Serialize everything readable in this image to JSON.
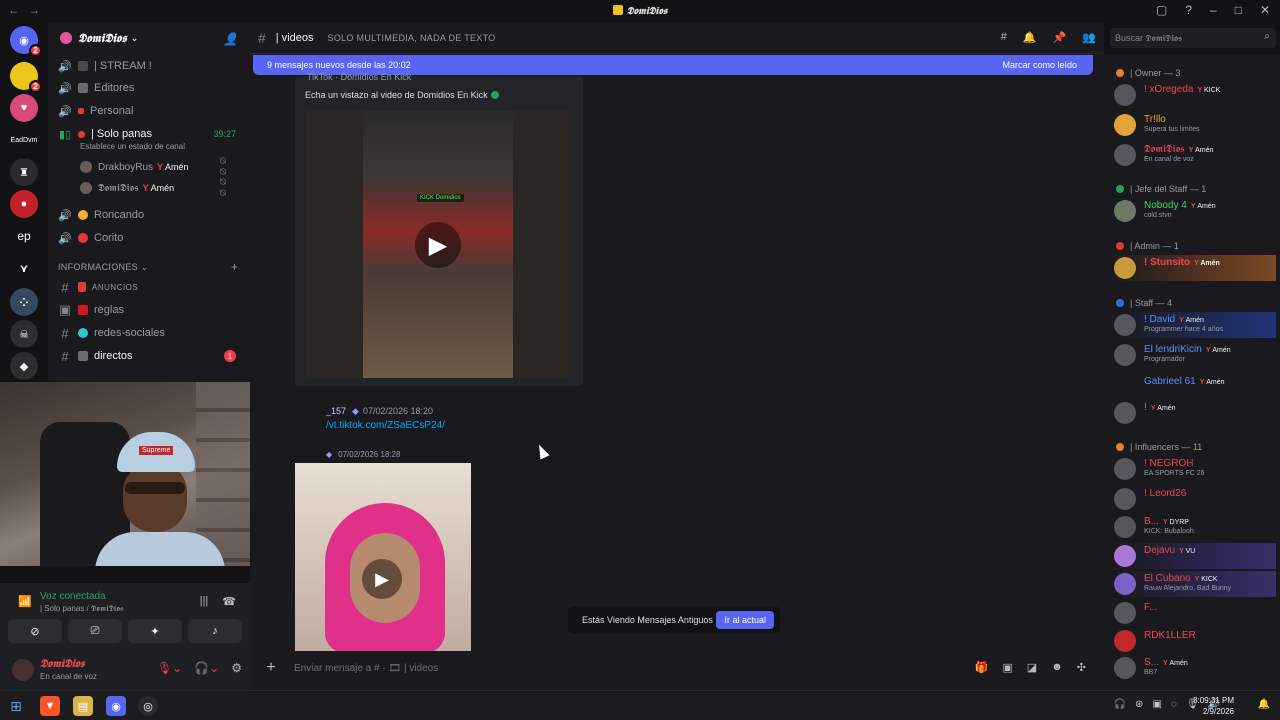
{
  "window": {
    "title": "𝕯𝖔𝖒𝖎𝕯𝖎𝖔𝖘"
  },
  "guild": {
    "name": "𝕯𝖔𝖒𝖎𝕯𝖎𝖔𝖘"
  },
  "channels": {
    "voice": [
      {
        "label": "| STREAM !"
      },
      {
        "label": "Editores"
      },
      {
        "label": "Personal"
      },
      {
        "label": "| Solo panas",
        "time": "39:27",
        "status": "Establece un estado de canal"
      },
      {
        "label": "Roncando"
      },
      {
        "label": "Corito"
      }
    ],
    "voice_users": [
      {
        "name": "DrakboyRus",
        "tag": "Amén"
      },
      {
        "name": "𝕯𝖔𝖒𝖎𝕯𝖎𝖔𝖘",
        "tag": "Amén"
      }
    ],
    "category": "INFORMACIONES",
    "text": [
      {
        "label": "ANUNCIOS"
      },
      {
        "label": "reglas"
      },
      {
        "label": "redes-sociales"
      },
      {
        "label": "directos",
        "badge": "1"
      }
    ]
  },
  "servers": [
    {
      "label": "",
      "badge": "2",
      "color": "#5865f2"
    },
    {
      "label": "",
      "badge": "2",
      "color": "#e8c61a"
    },
    {
      "label": "",
      "badge": "",
      "color": "#d94b7a"
    },
    {
      "label": "EadDvm",
      "badge": "",
      "color": "#121214"
    },
    {
      "label": "",
      "badge": "",
      "color": "#2b2b2e"
    },
    {
      "label": "",
      "badge": "",
      "color": "#c2202a"
    },
    {
      "label": "ep",
      "badge": "",
      "color": "#1e1f22"
    },
    {
      "label": "",
      "badge": "",
      "color": "#1e1f22"
    }
  ],
  "channel_header": {
    "name": "| videos",
    "topic": "SOLO MULTIMEDIA, NADA DE TEXTO"
  },
  "new_messages_bar": {
    "text": "9 mensajes nuevos desde las 20:02",
    "action": "Marcar como leído"
  },
  "messages": {
    "embed_title": "TikTok · Domidios En Kick",
    "embed_desc": "Echa un vistazo al video de Domidios En Kick",
    "embed_video_badge": "KICK Domidios",
    "msg2_user": "_157",
    "msg2_time": "07/02/2026 18:20",
    "msg2_link": "/vt.tiktok.com/ZSaECsP24/",
    "msg3_time": "07/02/2026 18:28"
  },
  "old_messages_bar": {
    "text": "Estás Viendo Mensajes Antiguos",
    "action": "Ir al actual"
  },
  "composer": {
    "placeholder": "Enviar mensaje a # · 🎞 | videos"
  },
  "search": {
    "placeholder": "Buscar 𝕯𝖔𝖒𝖎𝕯𝖎𝖔𝖘"
  },
  "voice_panel": {
    "status": "Voz conectada",
    "sub": "| Solo panas / 𝕯𝖔𝖒𝖎𝕯𝖎𝖔𝖘",
    "user_name": "𝕯𝖔𝖒𝖎𝕯𝖎𝖔𝖘",
    "user_status": "En canal de voz"
  },
  "members": {
    "groups": [
      {
        "label": "| Owner — 3",
        "color": "#e67e22"
      },
      {
        "label": "| Jefe del Staff — 1",
        "color": "#23a55a"
      },
      {
        "label": "| Admin — 1",
        "color": "#e53935"
      },
      {
        "label": "| Staff — 4",
        "color": "#3867d6"
      },
      {
        "label": "| Influencers — 11",
        "color": "#e67e22"
      }
    ],
    "owner": [
      {
        "name": "! xOregeda",
        "tag": "KICK",
        "sub": "",
        "color": "#e8484f"
      },
      {
        "name": "Tr!llo",
        "tag": "",
        "sub": "Supera tus limites",
        "color": "#e8a33d"
      },
      {
        "name": "𝕯𝖔𝖒𝖎𝕯𝖎𝖔𝖘",
        "tag": "Amén",
        "sub": "En canal de voz",
        "color": "#e8484f"
      }
    ],
    "jefe": [
      {
        "name": "Nobody 4",
        "tag": "Amén",
        "sub": "cold.stvn",
        "color": "#3ed46a"
      }
    ],
    "admin": [
      {
        "name": "! Stunsito",
        "tag": "Amén",
        "sub": "",
        "color": "#e8484f"
      }
    ],
    "staff": [
      {
        "name": "! David",
        "tag": "Amén",
        "sub": "Programmer hace 4 años",
        "color": "#5b8cff"
      },
      {
        "name": "El lendriKicin",
        "tag": "Amén",
        "sub": "Programador",
        "color": "#5b8cff"
      },
      {
        "name": "Gabrieel 61",
        "tag": "Amén",
        "sub": "",
        "color": "#5b8cff"
      },
      {
        "name": "!",
        "tag": "Amén",
        "sub": "",
        "color": "#5b8cff"
      }
    ],
    "influencers": [
      {
        "name": "! NEGROH",
        "tag": "",
        "sub": "EA SPORTS FC 26",
        "color": "#e8484f"
      },
      {
        "name": "! Leord26",
        "tag": "",
        "sub": "",
        "color": "#e8484f"
      },
      {
        "name": "B...",
        "tag": "DYRP",
        "sub": "KICK: Bubalooh",
        "color": "#e8484f"
      },
      {
        "name": "Dejavu",
        "tag": "VU",
        "sub": "",
        "color": "#e8484f"
      },
      {
        "name": "El Cubano",
        "tag": "KICK",
        "sub": "Rauw Alejandro, Bad Bunny",
        "color": "#e8484f"
      },
      {
        "name": "F...",
        "tag": "",
        "sub": "",
        "color": "#e8484f"
      },
      {
        "name": "RDK1LLER",
        "tag": "",
        "sub": "",
        "color": "#e8484f"
      },
      {
        "name": "S...",
        "tag": "Amén",
        "sub": "BB7",
        "color": "#e8484f"
      }
    ]
  },
  "taskbar": {
    "time": "8:09:31 PM",
    "date": "2/9/2026"
  }
}
